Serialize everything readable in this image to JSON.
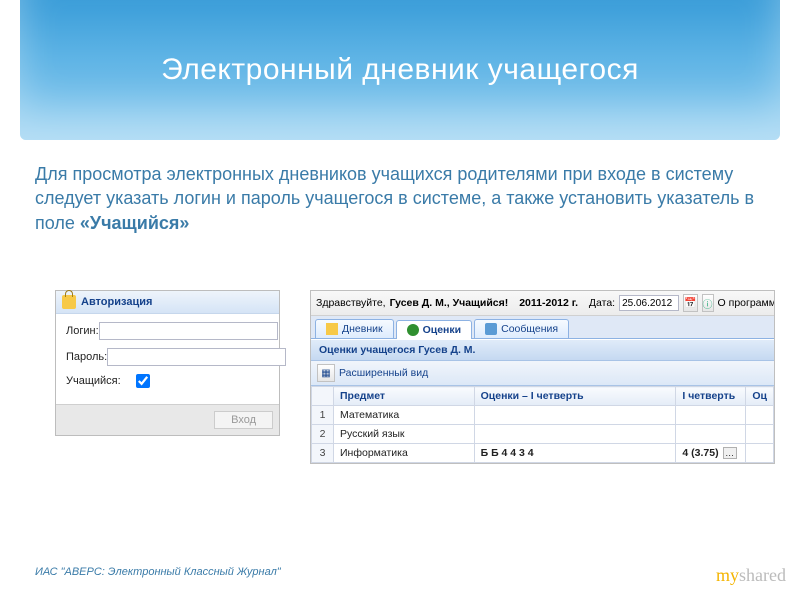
{
  "title": "Электронный дневник учащегося",
  "body_text_pre": "Для просмотра электронных дневников учащихся родителями при входе в систему следует указать логин и пароль учащегося в системе, а также установить указатель в поле ",
  "body_text_bold": "«Учащийся»",
  "auth": {
    "header": "Авторизация",
    "login_label": "Логин:",
    "password_label": "Пароль:",
    "student_label": "Учащийся:",
    "submit": "Вход"
  },
  "journal": {
    "greeting_pre": "Здравствуйте, ",
    "user": "Гусев Д. М., Учащийся!",
    "year": "2011-2012 г.",
    "date_label": "Дата:",
    "date_value": "25.06.2012",
    "about": "О программе",
    "tabs": {
      "diary": "Дневник",
      "grades": "Оценки",
      "messages": "Сообщения"
    },
    "grades_header": "Оценки учащегося Гусев Д. М.",
    "expanded_view": "Расширенный вид",
    "columns": {
      "subject": "Предмет",
      "term_marks": "Оценки – I четверть",
      "term": "I четверть",
      "last": "Оц"
    },
    "rows": [
      {
        "n": "1",
        "subject": "Математика",
        "marks": "",
        "term": ""
      },
      {
        "n": "2",
        "subject": "Русский язык",
        "marks": "",
        "term": ""
      },
      {
        "n": "3",
        "subject": "Информатика",
        "marks": "Б Б 4 4 3 4",
        "term": "4 (3.75)"
      }
    ]
  },
  "footer": "ИАС \"АВЕРС: Электронный Классный Журнал\"",
  "brand_my": "my",
  "brand_shared": "shared"
}
